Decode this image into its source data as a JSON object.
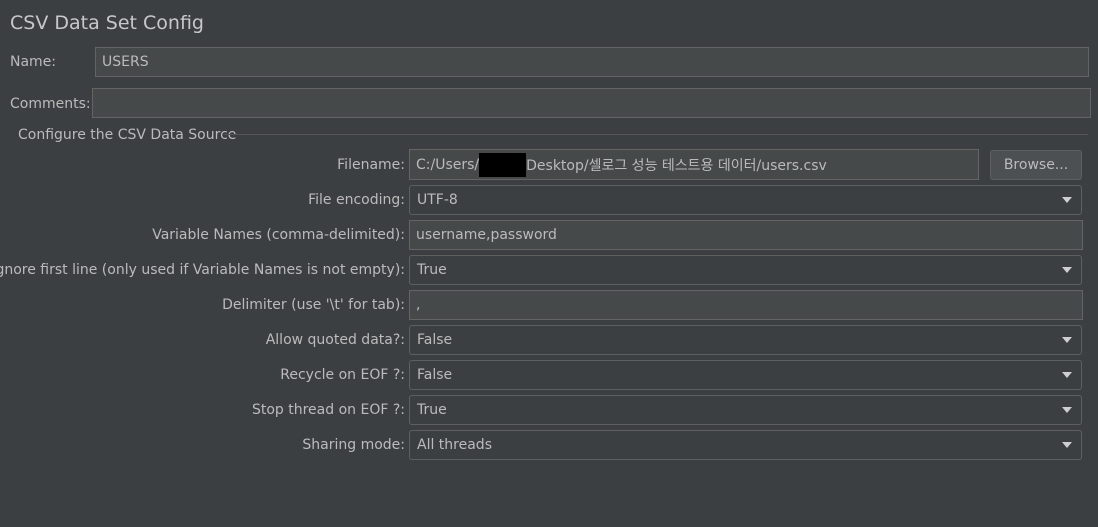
{
  "title": "CSV Data Set Config",
  "name": {
    "label": "Name:",
    "value": "USERS"
  },
  "comments": {
    "label": "Comments:",
    "value": ""
  },
  "section": "Configure the CSV Data Source",
  "filename": {
    "label": "Filename:",
    "prefix": "C:/Users/",
    "suffix": "Desktop/셀로그 성능 테스트용 데이터/users.csv"
  },
  "browse": "Browse...",
  "file_encoding": {
    "label": "File encoding:",
    "value": "UTF-8"
  },
  "variable_names": {
    "label": "Variable Names (comma-delimited):",
    "value": "username,password"
  },
  "ignore_first_line": {
    "label": "Ignore first line (only used if Variable Names is not empty):",
    "value": "True"
  },
  "delimiter": {
    "label": "Delimiter (use '\\t' for tab):",
    "value": ","
  },
  "allow_quoted": {
    "label": "Allow quoted data?:",
    "value": "False"
  },
  "recycle_eof": {
    "label": "Recycle on EOF ?:",
    "value": "False"
  },
  "stop_thread_eof": {
    "label": "Stop thread on EOF ?:",
    "value": "True"
  },
  "sharing_mode": {
    "label": "Sharing mode:",
    "value": "All threads"
  }
}
